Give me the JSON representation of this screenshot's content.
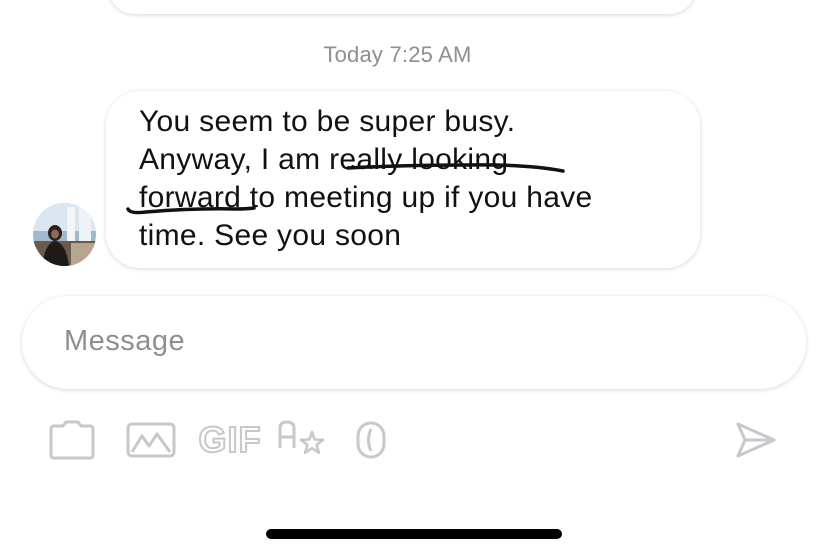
{
  "chat": {
    "timestamp": "Today 7:25 AM",
    "message": {
      "lines": [
        "You seem to be super busy.",
        "Anyway,  I am really looking",
        "forward to meeting up if you have",
        "time. See you soon"
      ]
    }
  },
  "composer": {
    "placeholder": "Message"
  },
  "toolbar": {
    "gif_label": "GIF",
    "icons": [
      "camera-icon",
      "gallery-icon",
      "gif-icon",
      "translate-icon",
      "sticker-icon",
      "send-icon"
    ]
  },
  "colors": {
    "muted_text": "#8e8e93",
    "icon_stroke": "#c7c7cc",
    "underline_ink": "#111111"
  }
}
